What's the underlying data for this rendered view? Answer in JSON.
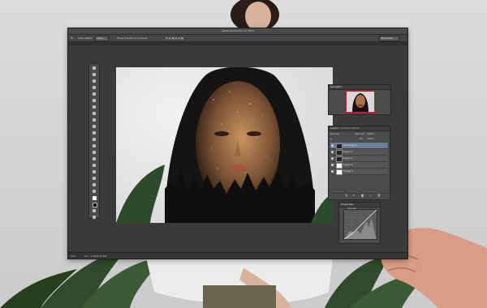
{
  "app": {
    "title": "Adobe Photoshop CC 2015",
    "workspace": "Essentials"
  },
  "options_bar": {
    "auto_select_label": "Auto-Select:",
    "auto_select_value": "Layer",
    "show_transform_label": "Show Transform Controls"
  },
  "tools": [
    "move-tool-icon",
    "marquee-tool-icon",
    "lasso-tool-icon",
    "quick-select-tool-icon",
    "crop-tool-icon",
    "eyedropper-tool-icon",
    "healing-brush-icon",
    "brush-tool-icon",
    "clone-stamp-icon",
    "history-brush-icon",
    "eraser-tool-icon",
    "gradient-tool-icon",
    "blur-tool-icon",
    "dodge-tool-icon",
    "pen-tool-icon",
    "type-tool-icon",
    "path-select-icon",
    "shape-tool-icon",
    "hand-tool-icon",
    "zoom-tool-icon",
    "foreground-color-swatch",
    "background-color-swatch",
    "quick-mask-icon",
    "screen-mode-icon"
  ],
  "navigator": {
    "title": "Navigator"
  },
  "layers": {
    "tabs": [
      "Layers",
      "Channels",
      "Paths"
    ],
    "blend_mode": "Normal",
    "opacity_label": "Opacity:",
    "opacity_value": "100%",
    "fill_label": "Fill:",
    "fill_value": "100%",
    "items": [
      {
        "name": "Rectangle 1"
      },
      {
        "name": "Layer 1"
      },
      {
        "name": "Layer 2"
      },
      {
        "name": "Layer 3"
      },
      {
        "name": "Shape 1"
      }
    ]
  },
  "curves": {
    "title": "Properties",
    "preset": "Curves"
  },
  "status": {
    "zoom": "50%",
    "doc": "Doc: 5.49M/39.8M"
  },
  "colors": {
    "accent": "#c62020",
    "selection": "#6c7d96",
    "panel": "#4b4b4b",
    "app_bg": "#3a3a3a"
  }
}
